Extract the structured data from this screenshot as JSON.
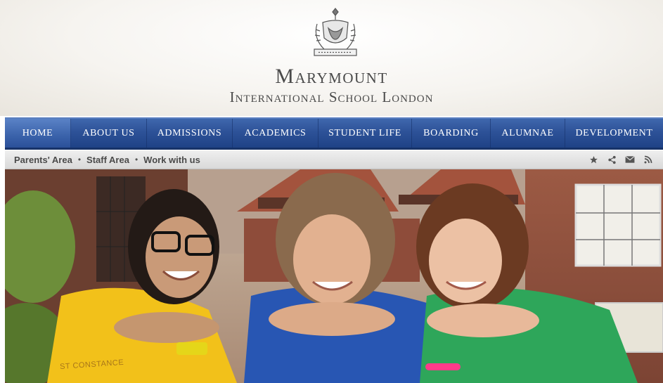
{
  "header": {
    "title_main": "Marymount",
    "title_sub": "International School London"
  },
  "nav": {
    "items": [
      {
        "label": "Home",
        "active": true
      },
      {
        "label": "About Us"
      },
      {
        "label": "Admissions"
      },
      {
        "label": "Academics"
      },
      {
        "label": "Student Life"
      },
      {
        "label": "Boarding"
      },
      {
        "label": "Alumnae"
      },
      {
        "label": "Development"
      }
    ]
  },
  "subbar": {
    "links": [
      "Parents' Area",
      "Staff Area",
      "Work with us"
    ],
    "separator": "•",
    "icons": [
      "star-icon",
      "share-icon",
      "mail-icon",
      "rss-icon"
    ]
  },
  "hero": {
    "shirt_text": "ST CONSTANCE"
  },
  "colors": {
    "nav_blue": "#2d5298",
    "subbar_gray": "#e3e3e3",
    "title_gray": "#4a4a4a"
  }
}
